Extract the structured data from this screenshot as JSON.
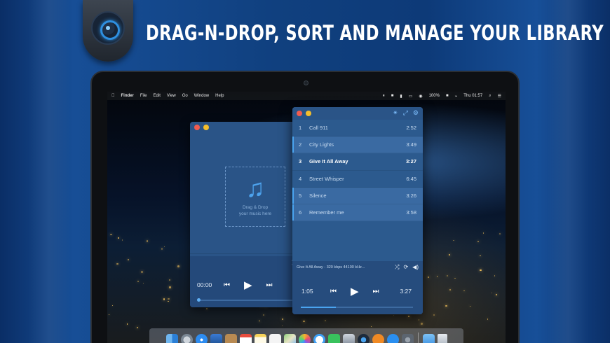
{
  "headline": "DRAG-N-DROP, SORT AND MANAGE YOUR LIBRARY",
  "badge": {
    "icon": "vinyl-disc-logo-icon"
  },
  "menubar": {
    "apple": "",
    "items": [
      "Finder",
      "File",
      "Edit",
      "View",
      "Go",
      "Window",
      "Help"
    ],
    "status": [
      "⏸",
      "■",
      "▮",
      "▭",
      "◉",
      "100%",
      "■",
      "⌁",
      "Thu 01:57",
      "⌕",
      "☰"
    ]
  },
  "left_window": {
    "drop_text": "Drag & Drop\nyour music here",
    "shuffle": "⤮",
    "time": "00:00",
    "prev": "⏮",
    "play": "▶",
    "next": "⏭"
  },
  "right_window": {
    "toolbar_icons": [
      "✴",
      "⤢",
      "⚙"
    ],
    "tracks": [
      {
        "num": "1",
        "title": "Call 911",
        "duration": "2:52"
      },
      {
        "num": "2",
        "title": "City Lights",
        "duration": "3:49"
      },
      {
        "num": "3",
        "title": "Give It All Away",
        "duration": "3:27"
      },
      {
        "num": "4",
        "title": "Street Whisper",
        "duration": "6:45"
      },
      {
        "num": "5",
        "title": "Silence",
        "duration": "3:26"
      },
      {
        "num": "6",
        "title": "Remember me",
        "duration": "3:58"
      }
    ],
    "now_playing": "Give It All Away - 320 kbps 44100 kHz...",
    "np_icons": [
      "⤮",
      "⟳",
      "◀)"
    ],
    "elapsed": "1:05",
    "total": "3:27",
    "prev": "⏮",
    "play": "▶",
    "next": "⏭",
    "progress": 0.31
  },
  "colors": {
    "accent": "#4aa4f0",
    "window_bg": "#2c5a8e",
    "close": "#f15b4f",
    "minimize": "#f5be2b"
  },
  "dock": {
    "apps": [
      "finder",
      "launchpad",
      "safari",
      "photos-viewer",
      "contacts",
      "calendar",
      "notes",
      "reminders",
      "maps",
      "photos",
      "messages",
      "facetime",
      "photo-booth",
      "music-player",
      "ibooks",
      "app-store",
      "system-preferences"
    ],
    "trailing": [
      "downloads-folder",
      "trash"
    ]
  }
}
